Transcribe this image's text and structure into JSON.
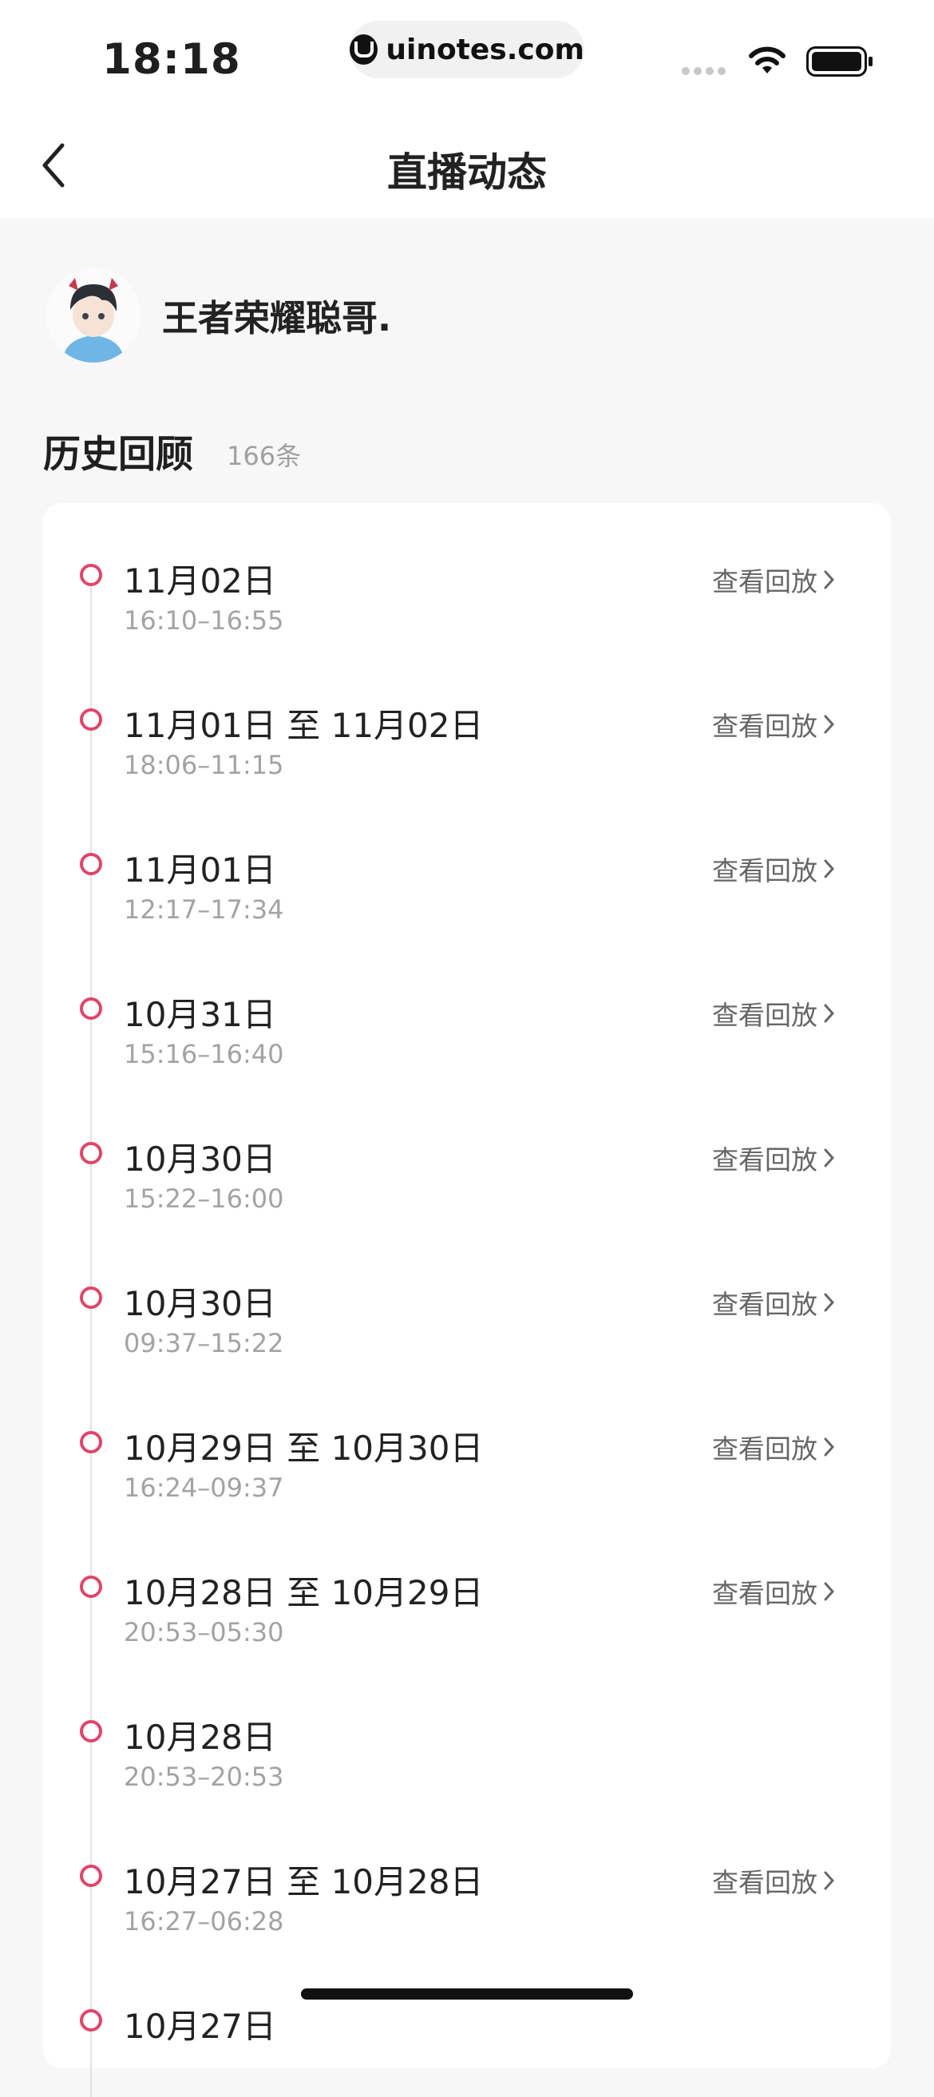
{
  "status_bar": {
    "time": "18:18",
    "url": "uinotes.com"
  },
  "nav": {
    "title": "直播动态",
    "back_icon": "chevron-left-icon"
  },
  "streamer": {
    "name": "王者荣耀聪哥."
  },
  "history": {
    "title": "历史回顾",
    "count": "166条"
  },
  "entries": [
    {
      "date": "11月02日",
      "time": "16:10–16:55",
      "replay": "查看回放"
    },
    {
      "date": "11月01日 至 11月02日",
      "time": "18:06–11:15",
      "replay": "查看回放"
    },
    {
      "date": "11月01日",
      "time": "12:17–17:34",
      "replay": "查看回放"
    },
    {
      "date": "10月31日",
      "time": "15:16–16:40",
      "replay": "查看回放"
    },
    {
      "date": "10月30日",
      "time": "15:22–16:00",
      "replay": "查看回放"
    },
    {
      "date": "10月30日",
      "time": "09:37–15:22",
      "replay": "查看回放"
    },
    {
      "date": "10月29日 至 10月30日",
      "time": "16:24–09:37",
      "replay": "查看回放"
    },
    {
      "date": "10月28日 至 10月29日",
      "time": "20:53–05:30",
      "replay": "查看回放"
    },
    {
      "date": "10月28日",
      "time": "20:53–20:53",
      "replay": ""
    },
    {
      "date": "10月27日 至 10月28日",
      "time": "16:27–06:28",
      "replay": "查看回放"
    },
    {
      "date": "10月27日",
      "time": "",
      "replay": ""
    }
  ],
  "colors": {
    "accent_dot": "#e0456b",
    "page_bg": "#f7f7f7",
    "card_bg": "#ffffff"
  }
}
